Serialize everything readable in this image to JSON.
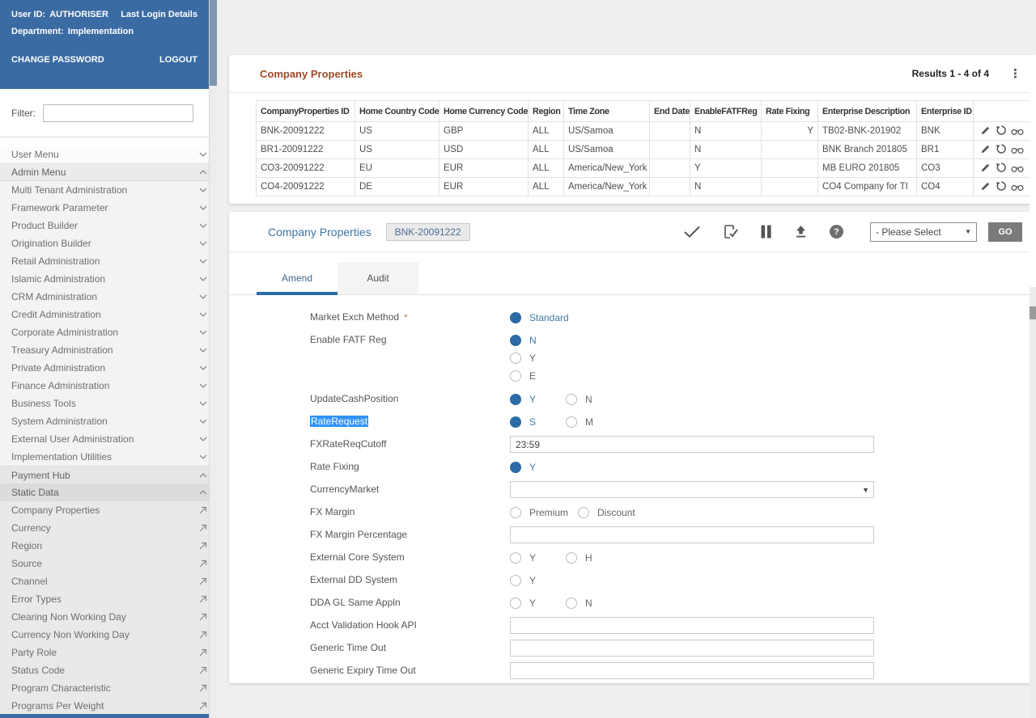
{
  "colors": {
    "header_blue": "#3a6ba3",
    "title_brown": "#9c4a28",
    "accent_blue": "#2e6da4",
    "link_blue": "#4073a3",
    "radio_blue": "#2b6ba6",
    "selection_blue": "#3193fa",
    "go_gray": "#7b7b7b"
  },
  "top_bar": {
    "user_id_label": "User ID:",
    "user_id": "AUTHORISER",
    "last_login": "Last Login Details",
    "department_label": "Department:",
    "department": "Implementation",
    "change_password": "CHANGE PASSWORD",
    "logout": "LOGOUT"
  },
  "sidebar": {
    "filter_label": "Filter:",
    "items": [
      {
        "label": "User Menu",
        "icon": "chevron-down",
        "style": "plain"
      },
      {
        "label": "Admin Menu",
        "icon": "chevron-up",
        "style": "activeparent"
      },
      {
        "label": "Multi Tenant Administration",
        "icon": "chevron-down",
        "style": "child"
      },
      {
        "label": "Framework Parameter",
        "icon": "chevron-down",
        "style": "child"
      },
      {
        "label": "Product Builder",
        "icon": "chevron-down",
        "style": "child"
      },
      {
        "label": "Origination Builder",
        "icon": "chevron-down",
        "style": "child"
      },
      {
        "label": "Retail Administration",
        "icon": "chevron-down",
        "style": "child"
      },
      {
        "label": "Islamic Administration",
        "icon": "chevron-down",
        "style": "child"
      },
      {
        "label": "CRM Administration",
        "icon": "chevron-down",
        "style": "child"
      },
      {
        "label": "Credit Administration",
        "icon": "chevron-down",
        "style": "child"
      },
      {
        "label": "Corporate Administration",
        "icon": "chevron-down",
        "style": "child"
      },
      {
        "label": "Treasury Administration",
        "icon": "chevron-down",
        "style": "child"
      },
      {
        "label": "Private Administration",
        "icon": "chevron-down",
        "style": "child"
      },
      {
        "label": "Finance Administration",
        "icon": "chevron-down",
        "style": "child"
      },
      {
        "label": "Business Tools",
        "icon": "chevron-down",
        "style": "child"
      },
      {
        "label": "System Administration",
        "icon": "chevron-down",
        "style": "child"
      },
      {
        "label": "External User Administration",
        "icon": "chevron-down",
        "style": "child"
      },
      {
        "label": "Implementation Utilities",
        "icon": "chevron-down",
        "style": "child"
      },
      {
        "label": "Payment Hub",
        "icon": "chevron-up",
        "style": "hub"
      },
      {
        "label": "Static Data",
        "icon": "chevron-up",
        "style": "static"
      },
      {
        "label": "Company Properties",
        "icon": "launch",
        "style": "leaf"
      },
      {
        "label": "Currency",
        "icon": "launch",
        "style": "leaf"
      },
      {
        "label": "Region",
        "icon": "launch",
        "style": "leaf"
      },
      {
        "label": "Source",
        "icon": "launch",
        "style": "leaf"
      },
      {
        "label": "Channel",
        "icon": "launch",
        "style": "leaf"
      },
      {
        "label": "Error Types",
        "icon": "launch",
        "style": "leaf"
      },
      {
        "label": "Clearing Non Working Day",
        "icon": "launch",
        "style": "leaf"
      },
      {
        "label": "Currency Non Working Day",
        "icon": "launch",
        "style": "leaf"
      },
      {
        "label": "Party Role",
        "icon": "launch",
        "style": "leaf"
      },
      {
        "label": "Status Code",
        "icon": "launch",
        "style": "leaf"
      },
      {
        "label": "Program Characteristic",
        "icon": "launch",
        "style": "leaf"
      },
      {
        "label": "Programs Per Weight",
        "icon": "launch",
        "style": "leaf"
      }
    ]
  },
  "results_panel": {
    "title": "Company Properties",
    "results_text": "Results 1 - 4 of 4",
    "kebab_icon": "kebab-menu-icon",
    "columns": [
      "CompanyProperties ID",
      "Home Country Code",
      "Home Currency Code",
      "Region",
      "Time Zone",
      "End Date",
      "EnableFATFReg",
      "Rate Fixing",
      "Enterprise Description",
      "Enterprise ID",
      ""
    ],
    "rows": [
      [
        "BNK-20091222",
        "US",
        "GBP",
        "ALL",
        "US/Samoa",
        "",
        "N",
        "Y",
        "TB02-BNK-201902",
        "BNK"
      ],
      [
        "BR1-20091222",
        "US",
        "USD",
        "ALL",
        "US/Samoa",
        "",
        "N",
        "",
        "BNK Branch 201805",
        "BR1"
      ],
      [
        "CO3-20091222",
        "EU",
        "EUR",
        "ALL",
        "America/New_York",
        "",
        "Y",
        "",
        "MB EURO 201805",
        "CO3"
      ],
      [
        "CO4-20091222",
        "DE",
        "EUR",
        "ALL",
        "America/New_York",
        "",
        "N",
        "",
        "CO4 Company for TI",
        "CO4"
      ]
    ],
    "row_action_icons": [
      "edit-pencil-icon",
      "undo-icon",
      "view-glasses-icon"
    ]
  },
  "detail_panel": {
    "title": "Company Properties",
    "record_badge": "BNK-20091222",
    "toolbar": {
      "icons": [
        "approve-check-icon",
        "authorize-doc-icon",
        "hold-pause-icon",
        "upload-icon",
        "help-icon"
      ],
      "action_select_value": "- Please Select",
      "go_label": "GO"
    },
    "tabs": [
      {
        "label": "Amend",
        "active": true
      },
      {
        "label": "Audit",
        "active": false
      }
    ],
    "form_rows": [
      {
        "label": "Market Exch Method",
        "required": true,
        "control": "radio",
        "options": [
          {
            "label": "Standard",
            "selected": true
          }
        ]
      },
      {
        "label": "Enable FATF Reg",
        "control": "radio-stack",
        "options": [
          {
            "label": "N",
            "selected": true
          },
          {
            "label": "Y",
            "selected": false
          },
          {
            "label": "E",
            "selected": false
          }
        ]
      },
      {
        "label": "UpdateCashPosition",
        "control": "radio",
        "options": [
          {
            "label": "Y",
            "selected": true
          },
          {
            "label": "N",
            "selected": false
          }
        ]
      },
      {
        "label": "RateRequest",
        "highlighted": true,
        "control": "radio",
        "options": [
          {
            "label": "S",
            "selected": true
          },
          {
            "label": "M",
            "selected": false
          }
        ]
      },
      {
        "label": "FXRateReqCutoff",
        "control": "text",
        "value": "23:59"
      },
      {
        "label": "Rate Fixing",
        "control": "radio",
        "options": [
          {
            "label": "Y",
            "selected": true
          }
        ]
      },
      {
        "label": "CurrencyMarket",
        "control": "select",
        "value": ""
      },
      {
        "label": "FX Margin",
        "control": "radio",
        "options": [
          {
            "label": "Premium",
            "selected": false
          },
          {
            "label": "Discount",
            "selected": false
          }
        ]
      },
      {
        "label": "FX Margin Percentage",
        "control": "text",
        "value": ""
      },
      {
        "label": "External Core System",
        "control": "radio",
        "options": [
          {
            "label": "Y",
            "selected": false
          },
          {
            "label": "H",
            "selected": false
          }
        ]
      },
      {
        "label": "External DD System",
        "control": "radio",
        "options": [
          {
            "label": "Y",
            "selected": false
          }
        ]
      },
      {
        "label": "DDA GL Same Appln",
        "control": "radio",
        "options": [
          {
            "label": "Y",
            "selected": false
          },
          {
            "label": "N",
            "selected": false
          }
        ]
      },
      {
        "label": "Acct Validation Hook API",
        "control": "text",
        "value": ""
      },
      {
        "label": "Generic Time Out",
        "control": "text",
        "value": ""
      },
      {
        "label": "Generic Expiry Time Out",
        "control": "text",
        "value": ""
      }
    ]
  }
}
